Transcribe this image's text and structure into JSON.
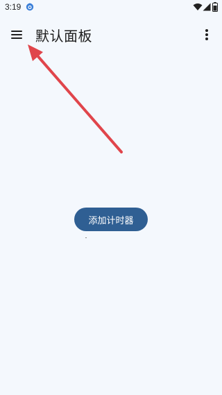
{
  "status_bar": {
    "time": "3:19",
    "app_icon": "blue-app-icon",
    "wifi_icon": "wifi-icon",
    "signal_icon": "signal-icon",
    "battery_icon": "battery-icon"
  },
  "app_bar": {
    "title": "默认面板",
    "menu_icon": "menu-icon",
    "more_icon": "more-vert-icon"
  },
  "main": {
    "add_timer_label": "添加计时器"
  },
  "colors": {
    "background": "#f4f8fd",
    "button": "#2f5f93",
    "arrow": "#e0454b"
  }
}
